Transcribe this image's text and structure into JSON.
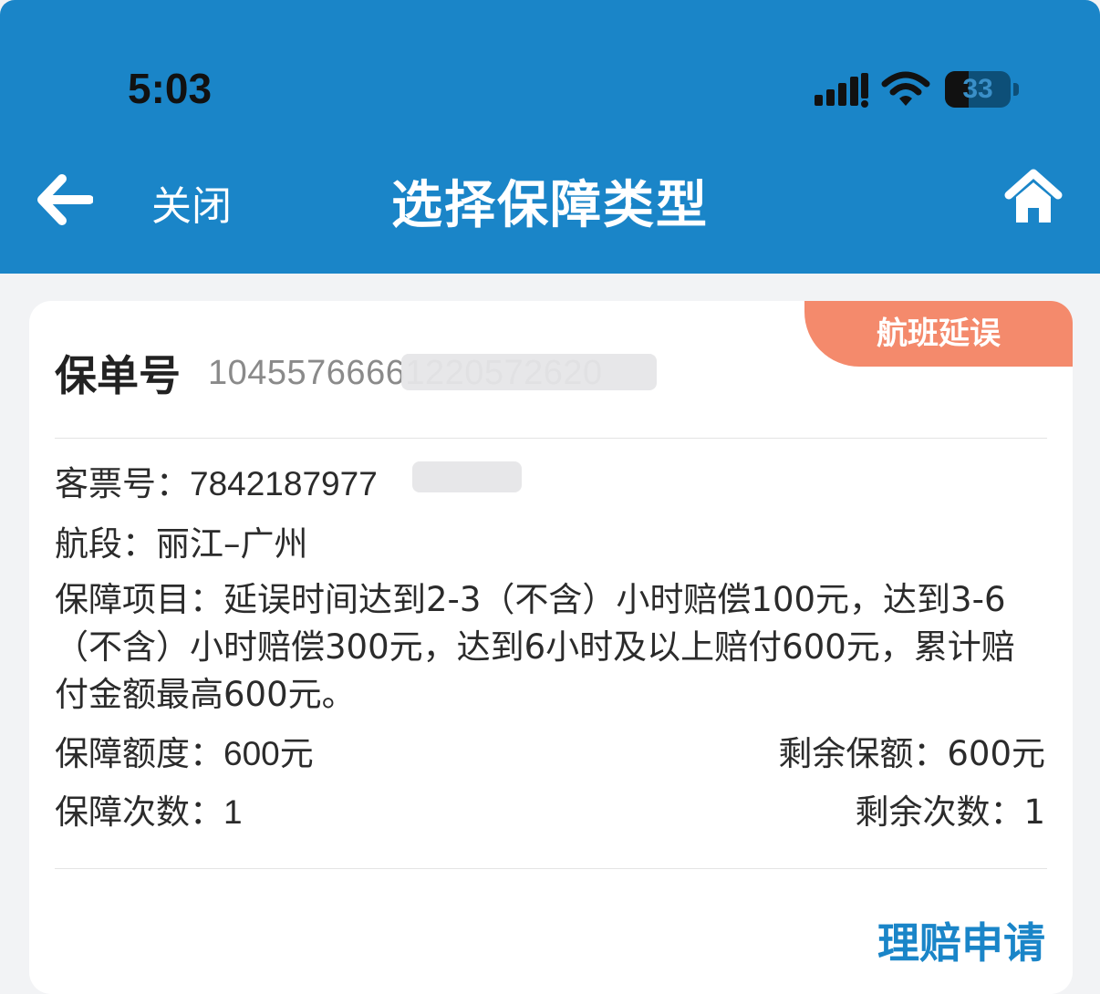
{
  "status_bar": {
    "time": "5:03",
    "battery_level": "33",
    "icons": [
      "cellular-signal-icon",
      "wifi-icon",
      "battery-icon"
    ]
  },
  "nav": {
    "back_icon": "arrow-left-icon",
    "close_label": "关闭",
    "title": "选择保障类型",
    "home_icon": "home-icon"
  },
  "policy": {
    "type_badge": "航班延误",
    "policy_label": "保单号",
    "policy_number": "10455766661220572620",
    "ticket_label": "客票号：",
    "ticket_number": "7842187977",
    "route_label": "航段：",
    "route_value": "丽江–广州",
    "coverage_label": "保障项目：",
    "coverage_value": "延误时间达到2-3（不含）小时赔偿100元，达到3-6（不含）小时赔偿300元，达到6小时及以上赔付600元，累计赔付金额最高600元。",
    "limit_label": "保障额度：",
    "limit_value": "600元",
    "remaining_amount_label": "剩余保额：",
    "remaining_amount_value": "600元",
    "times_label": "保障次数：",
    "times_value": "1",
    "remaining_times_label": "剩余次数：",
    "remaining_times_value": "1",
    "claim_link": "理赔申请"
  },
  "colors": {
    "header_blue": "#1a85c8",
    "badge_orange": "#f48a6c",
    "link_blue": "#1a85c8"
  }
}
